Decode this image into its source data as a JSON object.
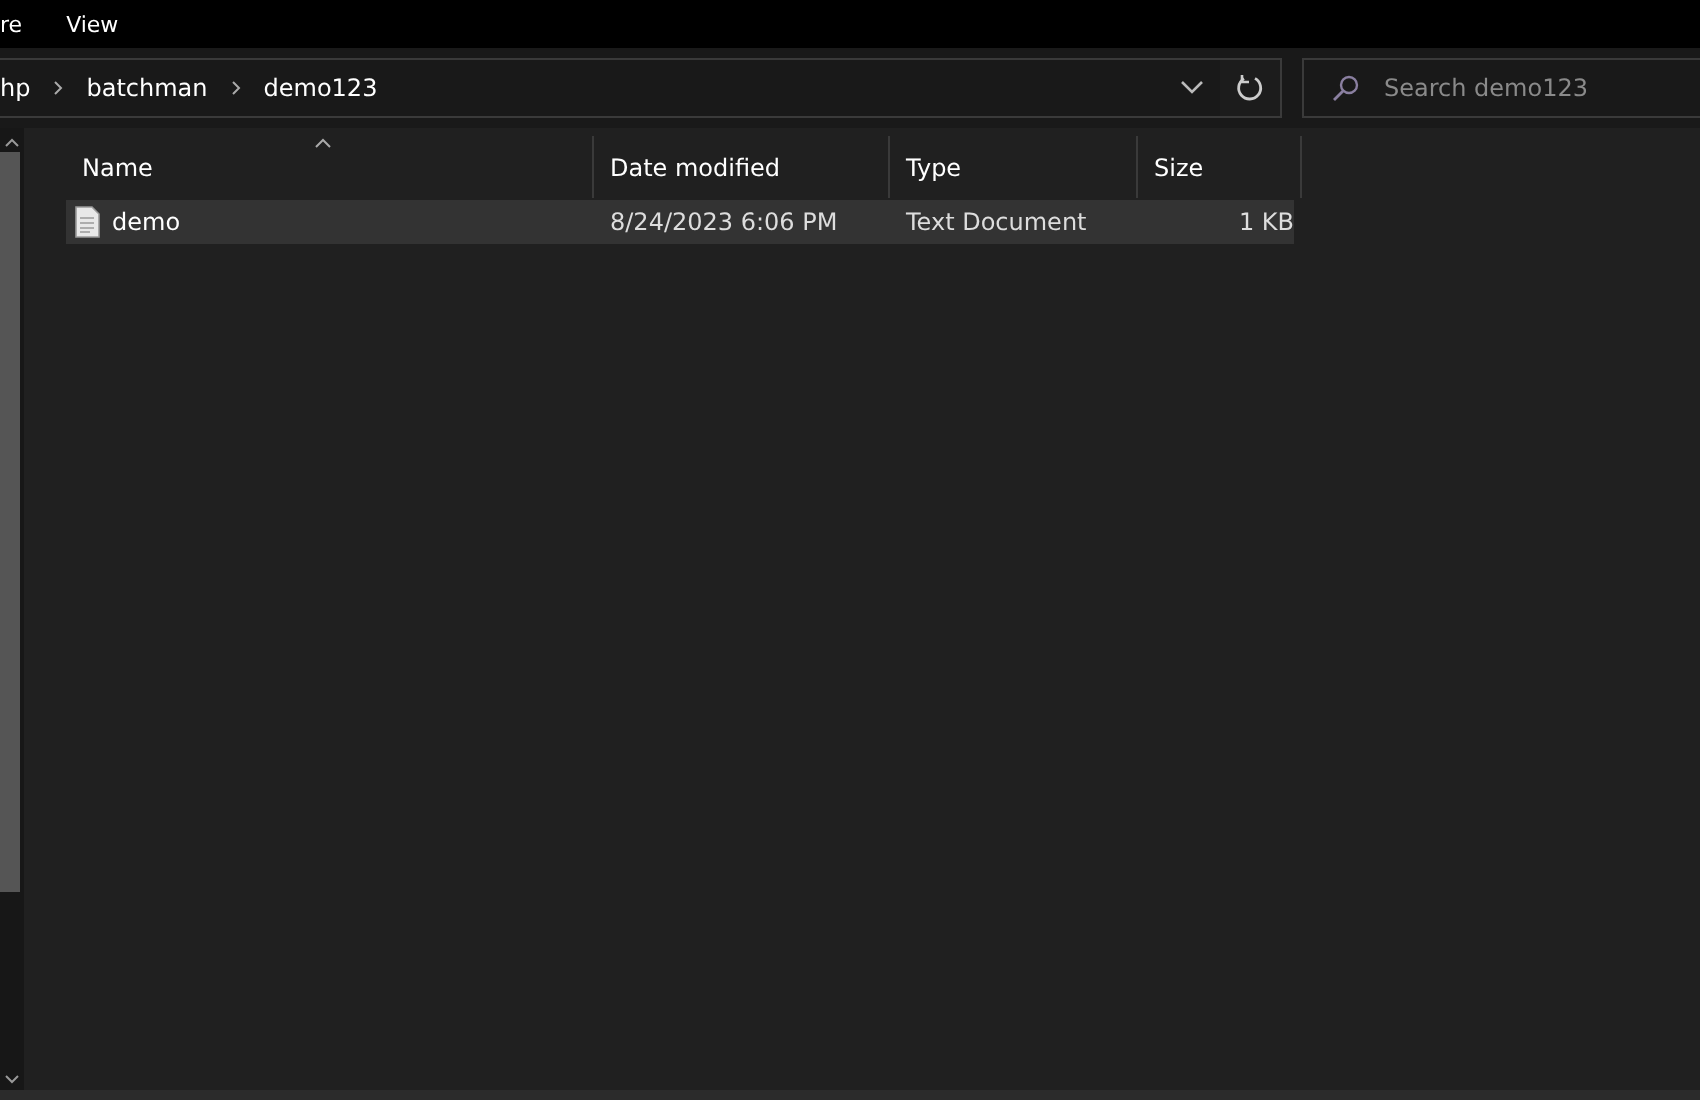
{
  "menu": [
    "re",
    "View"
  ],
  "breadcrumb": [
    "hp",
    "batchman",
    "demo123"
  ],
  "search": {
    "placeholder": "Search demo123"
  },
  "columns": [
    {
      "label": "Name",
      "sorted": true
    },
    {
      "label": "Date modified",
      "sorted": false
    },
    {
      "label": "Type",
      "sorted": false
    },
    {
      "label": "Size",
      "sorted": false
    }
  ],
  "rows": [
    {
      "name": "demo",
      "date": "8/24/2023 6:06 PM",
      "type": "Text Document",
      "size": "1 KB",
      "selected": true
    }
  ]
}
